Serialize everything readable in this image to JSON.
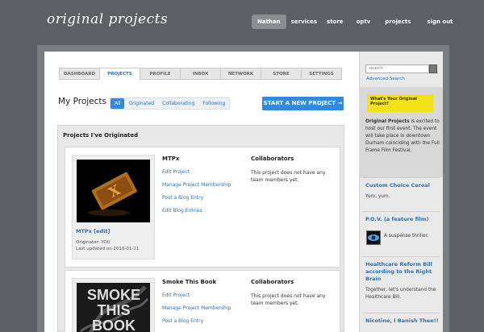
{
  "brand": {
    "logo_text": "original projects"
  },
  "topnav": {
    "items": [
      "Nathan",
      "services",
      "store",
      "optv",
      "projects",
      "sign out"
    ],
    "active": 0
  },
  "tabs": [
    "DASHBOARD",
    "PROJECTS",
    "PROFILE",
    "INBOX",
    "NETWORK",
    "STORE",
    "SETTINGS"
  ],
  "active_tab": 1,
  "main": {
    "title": "My Projects",
    "filters": [
      "All",
      "Originated",
      "Collaborating",
      "Following"
    ],
    "start_button": "START A NEW PROJECT →",
    "panel_title": "Projects I've Originated"
  },
  "projects": [
    {
      "name": "MTPx",
      "link_label": "MTPx [edit]",
      "originator": "Originator: YOU",
      "updated": "Last updated on 2010-01-21",
      "actions": [
        "Edit Project",
        "Manage Project Membership",
        "Post a Blog Entry",
        "Edit Blog Entries"
      ],
      "collab_title": "Collaborators",
      "collab_text": "This project does not have any team members yet."
    },
    {
      "name": "Smoke This Book",
      "thumb_text": "SMOKE THIS BOOK",
      "actions": [
        "Edit Project",
        "Manage Project Membership",
        "Post a Blog Entry"
      ],
      "collab_title": "Collaborators",
      "collab_text": "This project does not have any team members yet."
    }
  ],
  "sidebar": {
    "search_placeholder": "search",
    "advanced_search": "Advanced Search",
    "banner_text": "What's Your Original Project?",
    "desc_bold": "Original Projects",
    "desc_rest": " is excited to host our first event. The event will take place in downtown Durham coinciding with the Full Frame Film Festival.",
    "items": [
      {
        "title": "Custom Choice Cereal",
        "text": "Yum, yum."
      },
      {
        "title": "P.O.V. (a feature film)",
        "text": "A suspense thriller."
      },
      {
        "title": "Healthcare Reform Bill according to the Right Brain",
        "text": "Together, let's understand the Healthcare Bill."
      },
      {
        "title": "Nicotine, I Banish Thee!!",
        "text": ""
      }
    ]
  },
  "colors": {
    "accent": "#2f8ae0",
    "link": "#2f6fb0",
    "background": "#5c5f63",
    "banner": "#f2e21a"
  }
}
